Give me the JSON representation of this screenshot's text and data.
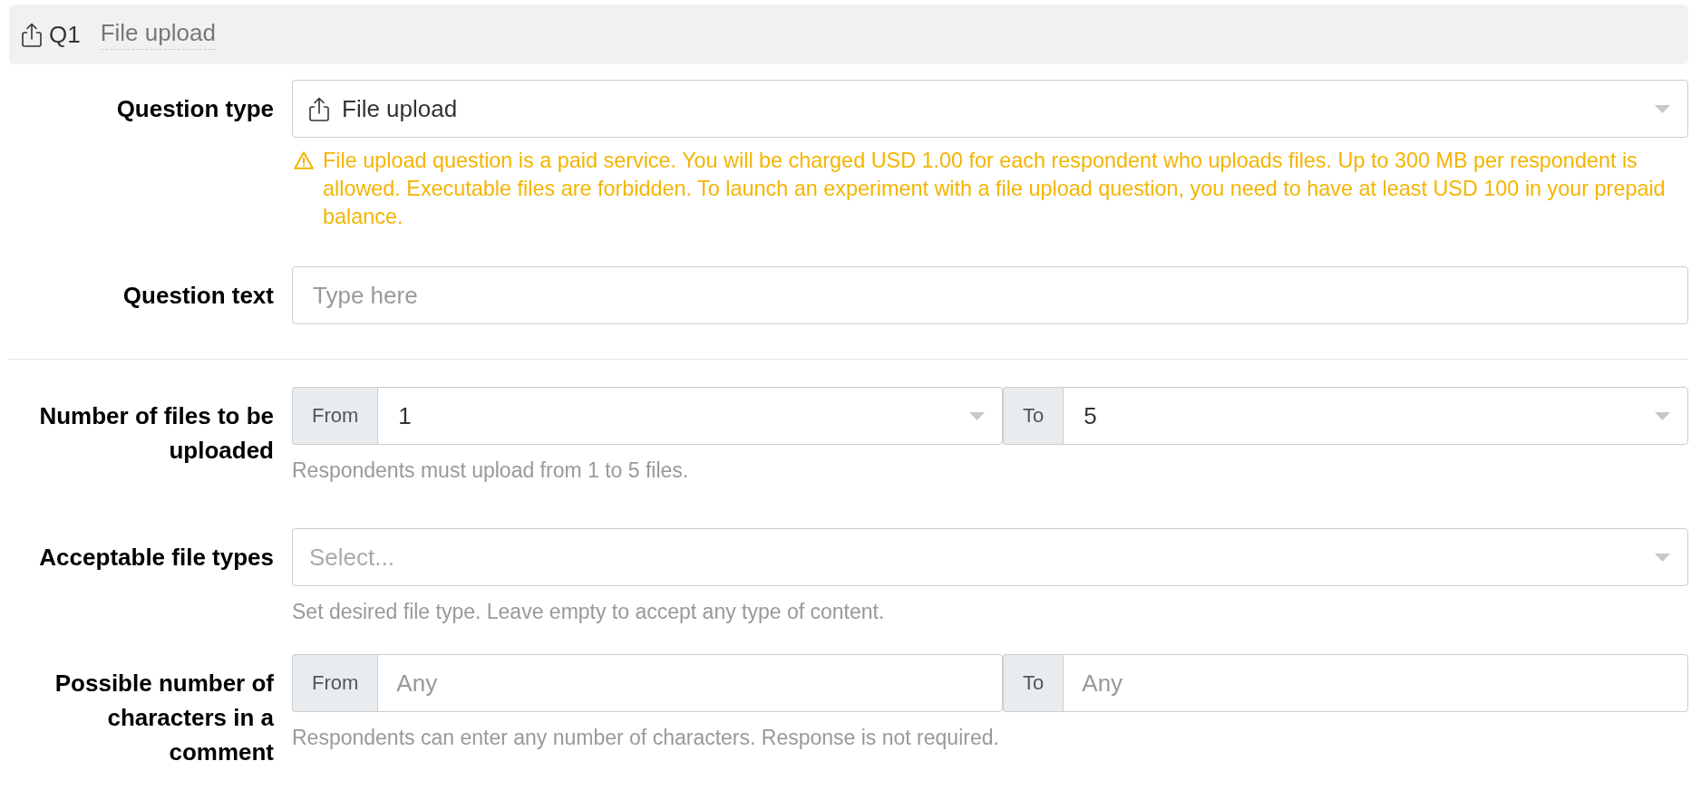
{
  "header": {
    "number": "Q1",
    "title": "File upload"
  },
  "general_fields": [
    {
      "kind": "select",
      "label": "Question type",
      "value": "File upload",
      "warning": "File upload question is a paid service. You will be charged USD 1.00 for each respondent who uploads files. Up to 300 MB per respondent is allowed. Executable files are forbidden. To launch an experiment with a file upload question, you need to have at least USD 100 in your prepaid balance."
    },
    {
      "kind": "text",
      "label": "Question text",
      "placeholder": "Type here"
    }
  ],
  "settings_fields": [
    {
      "kind": "range_select",
      "label": "Number of files to be uploaded",
      "from": {
        "label": "From",
        "value": "1"
      },
      "to": {
        "label": "To",
        "value": "5"
      },
      "help": "Respondents must upload from 1 to 5 files."
    },
    {
      "kind": "multi_select",
      "label": "Acceptable file types",
      "placeholder": "Select...",
      "help": "Set desired file type. Leave empty to accept any type of content."
    },
    {
      "kind": "range_input",
      "label": "Possible number of characters in a comment",
      "from": {
        "label": "From",
        "placeholder": "Any"
      },
      "to": {
        "label": "To",
        "placeholder": "Any"
      },
      "help": "Respondents can enter any number of characters. Response is not required."
    }
  ]
}
